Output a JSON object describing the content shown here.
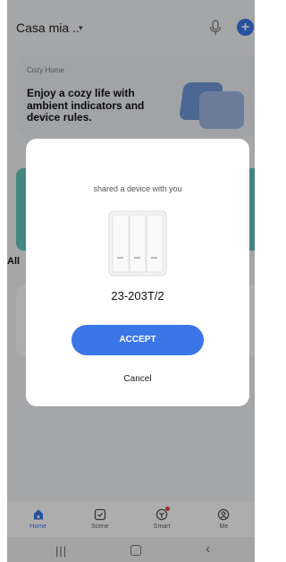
{
  "header": {
    "home_name": "Casa mia ..",
    "caret": "▾",
    "add_symbol": "+"
  },
  "banner": {
    "tag": "Cozy Home",
    "text": "Enjoy a cozy life with ambient indicators and device rules."
  },
  "background": {
    "all_label": "All",
    "more_dots": "· ·"
  },
  "dialog": {
    "shared_text": "shared a device with you",
    "device_name": "23-203T/2",
    "accept_label": "ACCEPT",
    "cancel_label": "Cancel"
  },
  "tabbar": {
    "tabs": [
      {
        "label": "Home",
        "icon": "home-icon"
      },
      {
        "label": "Scene",
        "icon": "scene-icon"
      },
      {
        "label": "Smart",
        "icon": "smart-icon"
      },
      {
        "label": "Me",
        "icon": "me-icon"
      }
    ]
  },
  "system_nav": {
    "recents": "|||",
    "back": "‹"
  },
  "colors": {
    "accent": "#3a76e8",
    "notification": "#e8453c",
    "teal": "#66c9c0"
  }
}
